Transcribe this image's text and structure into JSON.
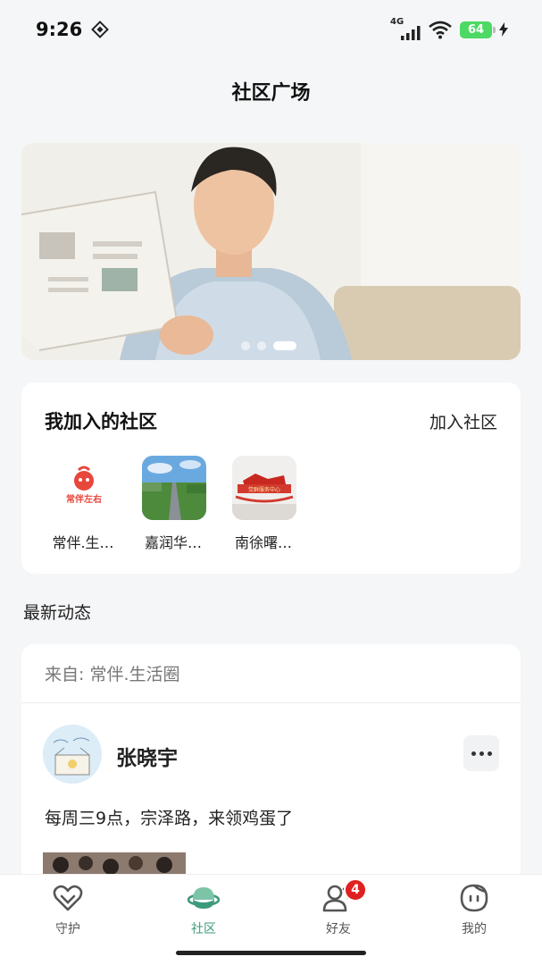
{
  "status": {
    "time": "9:26",
    "network": "4G",
    "wifi_sub": "6",
    "battery": "64"
  },
  "header": {
    "title": "社区广场"
  },
  "my_communities": {
    "title": "我加入的社区",
    "join_label": "加入社区",
    "items": [
      {
        "name": "常伴.生…",
        "logo_text": "常伴左右"
      },
      {
        "name": "嘉润华…"
      },
      {
        "name": "南徐曙…",
        "sign_text": "党群服务中心"
      }
    ]
  },
  "feed": {
    "section_label": "最新动态",
    "post": {
      "source": "来自: 常伴.生活圈",
      "author": "张晓宇",
      "text": "每周三9点，宗泽路，来领鸡蛋了"
    }
  },
  "tabs": [
    {
      "label": "守护",
      "icon": "heart-shield-icon"
    },
    {
      "label": "社区",
      "icon": "planet-icon"
    },
    {
      "label": "好友",
      "icon": "friends-icon",
      "badge": "4"
    },
    {
      "label": "我的",
      "icon": "face-icon"
    }
  ],
  "colors": {
    "accent": "#3c9a7c",
    "badge": "#e02020",
    "battery": "#4cd964",
    "brand_red": "#e8473c"
  }
}
